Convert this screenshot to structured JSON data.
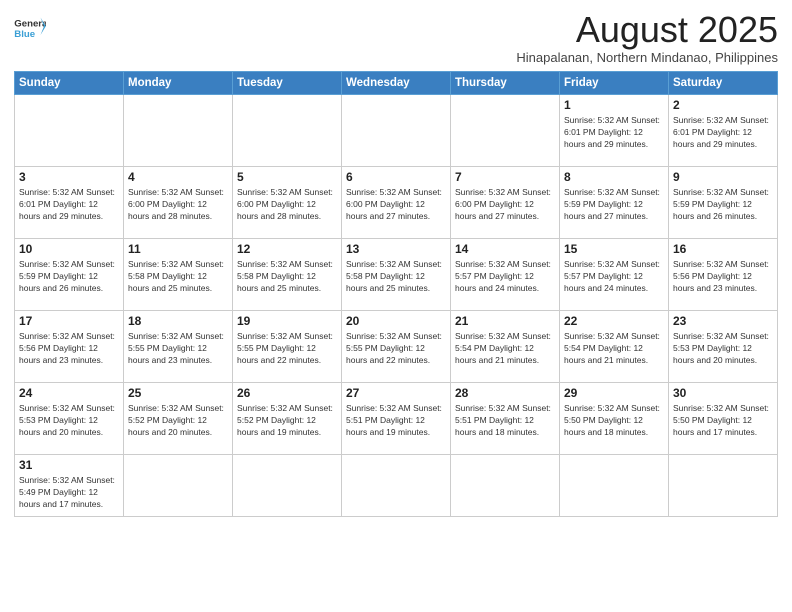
{
  "header": {
    "logo_general": "General",
    "logo_blue": "Blue",
    "title": "August 2025",
    "subtitle": "Hinapalanan, Northern Mindanao, Philippines"
  },
  "days_of_week": [
    "Sunday",
    "Monday",
    "Tuesday",
    "Wednesday",
    "Thursday",
    "Friday",
    "Saturday"
  ],
  "weeks": [
    {
      "days": [
        {
          "num": "",
          "info": ""
        },
        {
          "num": "",
          "info": ""
        },
        {
          "num": "",
          "info": ""
        },
        {
          "num": "",
          "info": ""
        },
        {
          "num": "",
          "info": ""
        },
        {
          "num": "1",
          "info": "Sunrise: 5:32 AM\nSunset: 6:01 PM\nDaylight: 12 hours\nand 29 minutes."
        },
        {
          "num": "2",
          "info": "Sunrise: 5:32 AM\nSunset: 6:01 PM\nDaylight: 12 hours\nand 29 minutes."
        }
      ]
    },
    {
      "days": [
        {
          "num": "3",
          "info": "Sunrise: 5:32 AM\nSunset: 6:01 PM\nDaylight: 12 hours\nand 29 minutes."
        },
        {
          "num": "4",
          "info": "Sunrise: 5:32 AM\nSunset: 6:00 PM\nDaylight: 12 hours\nand 28 minutes."
        },
        {
          "num": "5",
          "info": "Sunrise: 5:32 AM\nSunset: 6:00 PM\nDaylight: 12 hours\nand 28 minutes."
        },
        {
          "num": "6",
          "info": "Sunrise: 5:32 AM\nSunset: 6:00 PM\nDaylight: 12 hours\nand 27 minutes."
        },
        {
          "num": "7",
          "info": "Sunrise: 5:32 AM\nSunset: 6:00 PM\nDaylight: 12 hours\nand 27 minutes."
        },
        {
          "num": "8",
          "info": "Sunrise: 5:32 AM\nSunset: 5:59 PM\nDaylight: 12 hours\nand 27 minutes."
        },
        {
          "num": "9",
          "info": "Sunrise: 5:32 AM\nSunset: 5:59 PM\nDaylight: 12 hours\nand 26 minutes."
        }
      ]
    },
    {
      "days": [
        {
          "num": "10",
          "info": "Sunrise: 5:32 AM\nSunset: 5:59 PM\nDaylight: 12 hours\nand 26 minutes."
        },
        {
          "num": "11",
          "info": "Sunrise: 5:32 AM\nSunset: 5:58 PM\nDaylight: 12 hours\nand 25 minutes."
        },
        {
          "num": "12",
          "info": "Sunrise: 5:32 AM\nSunset: 5:58 PM\nDaylight: 12 hours\nand 25 minutes."
        },
        {
          "num": "13",
          "info": "Sunrise: 5:32 AM\nSunset: 5:58 PM\nDaylight: 12 hours\nand 25 minutes."
        },
        {
          "num": "14",
          "info": "Sunrise: 5:32 AM\nSunset: 5:57 PM\nDaylight: 12 hours\nand 24 minutes."
        },
        {
          "num": "15",
          "info": "Sunrise: 5:32 AM\nSunset: 5:57 PM\nDaylight: 12 hours\nand 24 minutes."
        },
        {
          "num": "16",
          "info": "Sunrise: 5:32 AM\nSunset: 5:56 PM\nDaylight: 12 hours\nand 23 minutes."
        }
      ]
    },
    {
      "days": [
        {
          "num": "17",
          "info": "Sunrise: 5:32 AM\nSunset: 5:56 PM\nDaylight: 12 hours\nand 23 minutes."
        },
        {
          "num": "18",
          "info": "Sunrise: 5:32 AM\nSunset: 5:55 PM\nDaylight: 12 hours\nand 23 minutes."
        },
        {
          "num": "19",
          "info": "Sunrise: 5:32 AM\nSunset: 5:55 PM\nDaylight: 12 hours\nand 22 minutes."
        },
        {
          "num": "20",
          "info": "Sunrise: 5:32 AM\nSunset: 5:55 PM\nDaylight: 12 hours\nand 22 minutes."
        },
        {
          "num": "21",
          "info": "Sunrise: 5:32 AM\nSunset: 5:54 PM\nDaylight: 12 hours\nand 21 minutes."
        },
        {
          "num": "22",
          "info": "Sunrise: 5:32 AM\nSunset: 5:54 PM\nDaylight: 12 hours\nand 21 minutes."
        },
        {
          "num": "23",
          "info": "Sunrise: 5:32 AM\nSunset: 5:53 PM\nDaylight: 12 hours\nand 20 minutes."
        }
      ]
    },
    {
      "days": [
        {
          "num": "24",
          "info": "Sunrise: 5:32 AM\nSunset: 5:53 PM\nDaylight: 12 hours\nand 20 minutes."
        },
        {
          "num": "25",
          "info": "Sunrise: 5:32 AM\nSunset: 5:52 PM\nDaylight: 12 hours\nand 20 minutes."
        },
        {
          "num": "26",
          "info": "Sunrise: 5:32 AM\nSunset: 5:52 PM\nDaylight: 12 hours\nand 19 minutes."
        },
        {
          "num": "27",
          "info": "Sunrise: 5:32 AM\nSunset: 5:51 PM\nDaylight: 12 hours\nand 19 minutes."
        },
        {
          "num": "28",
          "info": "Sunrise: 5:32 AM\nSunset: 5:51 PM\nDaylight: 12 hours\nand 18 minutes."
        },
        {
          "num": "29",
          "info": "Sunrise: 5:32 AM\nSunset: 5:50 PM\nDaylight: 12 hours\nand 18 minutes."
        },
        {
          "num": "30",
          "info": "Sunrise: 5:32 AM\nSunset: 5:50 PM\nDaylight: 12 hours\nand 17 minutes."
        }
      ]
    },
    {
      "days": [
        {
          "num": "31",
          "info": "Sunrise: 5:32 AM\nSunset: 5:49 PM\nDaylight: 12 hours\nand 17 minutes."
        },
        {
          "num": "",
          "info": ""
        },
        {
          "num": "",
          "info": ""
        },
        {
          "num": "",
          "info": ""
        },
        {
          "num": "",
          "info": ""
        },
        {
          "num": "",
          "info": ""
        },
        {
          "num": "",
          "info": ""
        }
      ]
    }
  ]
}
